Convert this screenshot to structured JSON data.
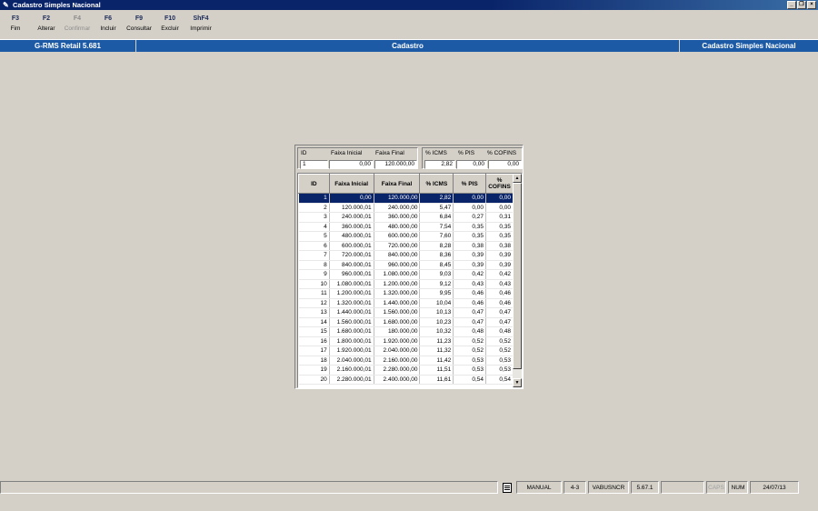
{
  "window": {
    "title": "Cadastro Simples Nacional"
  },
  "toolbar": [
    {
      "key": "F3",
      "label": "Fim",
      "enabled": true
    },
    {
      "key": "F2",
      "label": "Alterar",
      "enabled": true
    },
    {
      "key": "F4",
      "label": "Confirmar",
      "enabled": false
    },
    {
      "key": "F6",
      "label": "Incluir",
      "enabled": true
    },
    {
      "key": "F9",
      "label": "Consultar",
      "enabled": true
    },
    {
      "key": "F10",
      "label": "Excluir",
      "enabled": true
    },
    {
      "key": "ShF4",
      "label": "Imprimir",
      "enabled": true
    }
  ],
  "header": {
    "left": "G-RMS Retail 5.681",
    "center": "Cadastro",
    "right": "Cadastro Simples Nacional"
  },
  "form": {
    "id_label": "ID",
    "id_value": "1",
    "faixa_inicial_label": "Faixa Inicial",
    "faixa_inicial_value": "0,00",
    "faixa_final_label": "Faixa Final",
    "faixa_final_value": "120.000,00",
    "icms_label": "% ICMS",
    "icms_value": "2,82",
    "pis_label": "% PIS",
    "pis_value": "0,00",
    "cofins_label": "% COFINS",
    "cofins_value": "0,00"
  },
  "grid": {
    "columns": [
      "ID",
      "Faixa Inicial",
      "Faixa Final",
      "% ICMS",
      "% PIS",
      "% COFINS"
    ],
    "rows": [
      [
        "1",
        "0,00",
        "120.000,00",
        "2,82",
        "0,00",
        "0,00"
      ],
      [
        "2",
        "120.000,01",
        "240.000,00",
        "5,47",
        "0,00",
        "0,00"
      ],
      [
        "3",
        "240.000,01",
        "360.000,00",
        "6,84",
        "0,27",
        "0,31"
      ],
      [
        "4",
        "360.000,01",
        "480.000,00",
        "7,54",
        "0,35",
        "0,35"
      ],
      [
        "5",
        "480.000,01",
        "600.000,00",
        "7,60",
        "0,35",
        "0,35"
      ],
      [
        "6",
        "600.000,01",
        "720.000,00",
        "8,28",
        "0,38",
        "0,38"
      ],
      [
        "7",
        "720.000,01",
        "840.000,00",
        "8,36",
        "0,39",
        "0,39"
      ],
      [
        "8",
        "840.000,01",
        "960.000,00",
        "8,45",
        "0,39",
        "0,39"
      ],
      [
        "9",
        "960.000,01",
        "1.080.000,00",
        "9,03",
        "0,42",
        "0,42"
      ],
      [
        "10",
        "1.080.000,01",
        "1.200.000,00",
        "9,12",
        "0,43",
        "0,43"
      ],
      [
        "11",
        "1.200.000,01",
        "1.320.000,00",
        "9,95",
        "0,46",
        "0,46"
      ],
      [
        "12",
        "1.320.000,01",
        "1.440.000,00",
        "10,04",
        "0,46",
        "0,46"
      ],
      [
        "13",
        "1.440.000,01",
        "1.560.000,00",
        "10,13",
        "0,47",
        "0,47"
      ],
      [
        "14",
        "1.560.000,01",
        "1.680.000,00",
        "10,23",
        "0,47",
        "0,47"
      ],
      [
        "15",
        "1.680.000,01",
        "180.000,00",
        "10,32",
        "0,48",
        "0,48"
      ],
      [
        "16",
        "1.800.000,01",
        "1.920.000,00",
        "11,23",
        "0,52",
        "0,52"
      ],
      [
        "17",
        "1.920.000,01",
        "2.040.000,00",
        "11,32",
        "0,52",
        "0,52"
      ],
      [
        "18",
        "2.040.000,01",
        "2.160.000,00",
        "11,42",
        "0,53",
        "0,53"
      ],
      [
        "19",
        "2.160.000,01",
        "2.280.000,00",
        "11,51",
        "0,53",
        "0,53"
      ],
      [
        "20",
        "2.280.000,01",
        "2.400.000,00",
        "11,61",
        "0,54",
        "0,54"
      ]
    ],
    "selected_row": 0
  },
  "statusbar": {
    "mode": "MANUAL",
    "code": "4-3",
    "program": "VABUSNCR",
    "version": "5.67.1",
    "caps": "CAPS",
    "num": "NUM",
    "date": "24/07/13"
  }
}
